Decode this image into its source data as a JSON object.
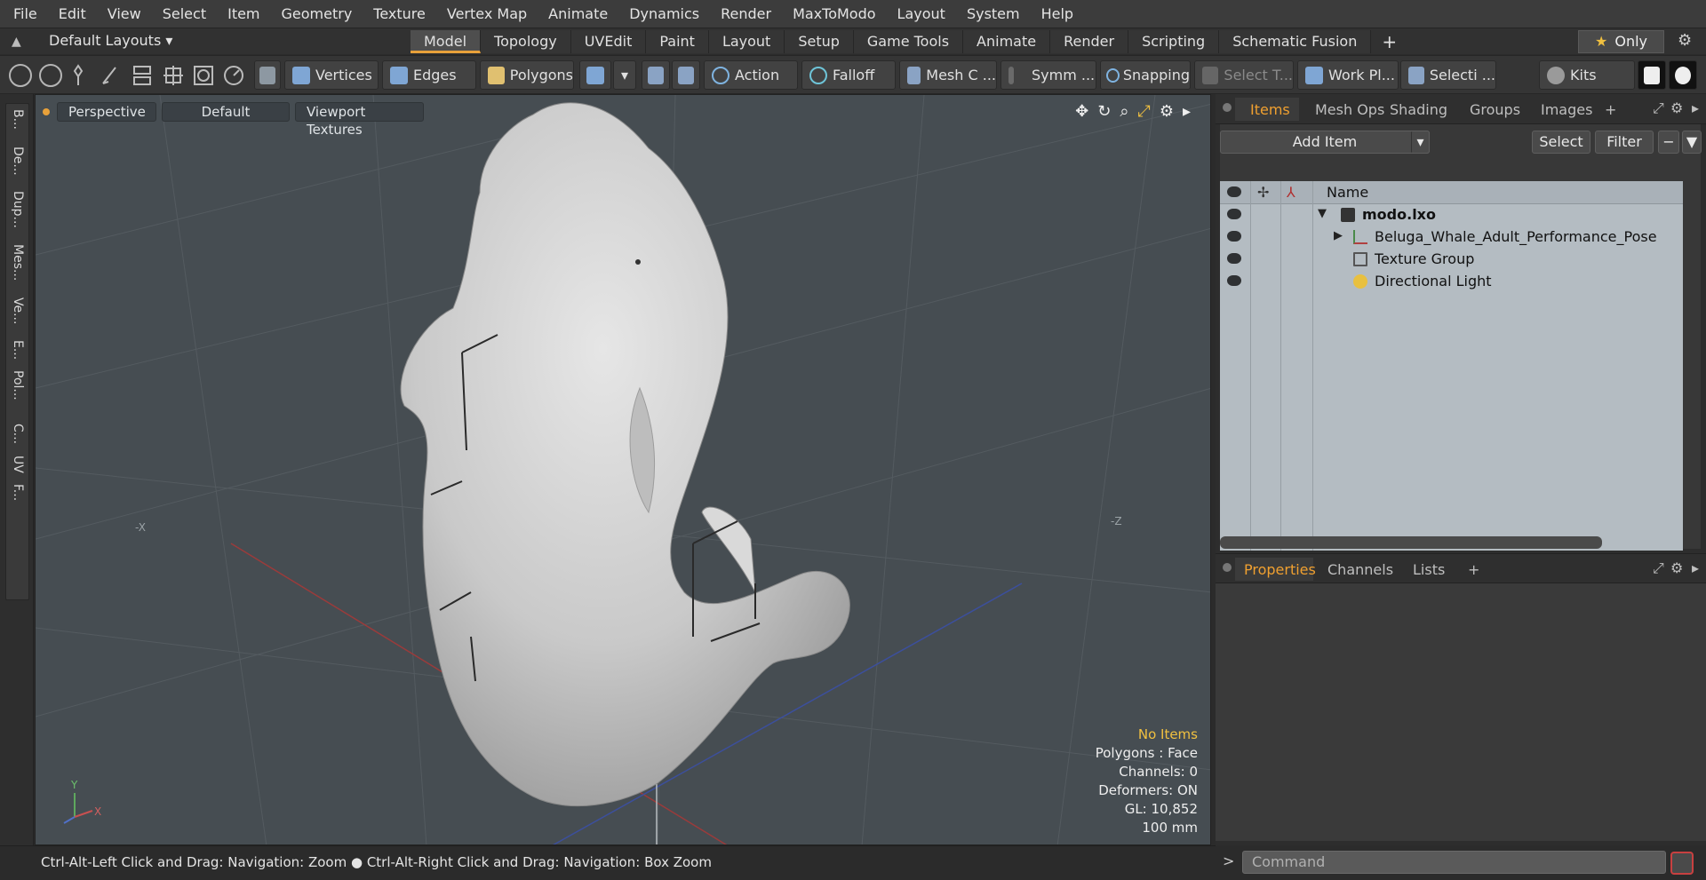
{
  "menu": [
    "File",
    "Edit",
    "View",
    "Select",
    "Item",
    "Geometry",
    "Texture",
    "Vertex Map",
    "Animate",
    "Dynamics",
    "Render",
    "MaxToModo",
    "Layout",
    "System",
    "Help"
  ],
  "layout_selector": "Default Layouts",
  "tabs": [
    "Model",
    "Topology",
    "UVEdit",
    "Paint",
    "Layout",
    "Setup",
    "Game Tools",
    "Animate",
    "Render",
    "Scripting",
    "Schematic Fusion"
  ],
  "tab_plus": "+",
  "only_label": "Only",
  "toolbar": {
    "vertices": "Vertices",
    "edges": "Edges",
    "polygons": "Polygons",
    "action": "Action",
    "falloff": "Falloff",
    "mesh": "Mesh C ...",
    "symm": "Symm ...",
    "snapping": "Snapping",
    "select_t": "Select T...",
    "workplane": "Work Pl...",
    "selection": "Selecti ...",
    "kits": "Kits"
  },
  "left_tools": [
    "B...",
    "De...",
    "Dup...",
    "Mes...",
    "Ve...",
    "E...",
    "Pol...",
    "C...",
    "UV",
    "F..."
  ],
  "viewport": {
    "view": "Perspective",
    "shading": "Default",
    "textures": "Viewport Textures",
    "axis_x_label": "-X",
    "axis_z_label": "-Z",
    "gizmo_y": "Y",
    "gizmo_x": "X",
    "stats": {
      "items": "No Items",
      "polygons": "Polygons : Face",
      "channels": "Channels: 0",
      "deformers": "Deformers: ON",
      "gl": "GL: 10,852",
      "scale": "100 mm"
    }
  },
  "status_text": "Ctrl-Alt-Left Click and Drag: Navigation: Zoom ● Ctrl-Alt-Right Click and Drag: Navigation: Box Zoom",
  "right_tabs": [
    "Items",
    "Mesh Ops",
    "Shading",
    "Groups",
    "Images"
  ],
  "items_panel": {
    "add_item": "Add Item",
    "select": "Select",
    "filter": "Filter",
    "name_col": "Name",
    "rows": [
      "modo.lxo",
      "Beluga_Whale_Adult_Performance_Pose",
      "Texture Group",
      "Directional Light"
    ]
  },
  "props_tabs": [
    "Properties",
    "Channels",
    "Lists"
  ],
  "command_placeholder": "Command",
  "colors": {
    "accent": "#e8a13a",
    "viewport_bg": "#464d52",
    "tree_bg": "#b4bcc2"
  }
}
